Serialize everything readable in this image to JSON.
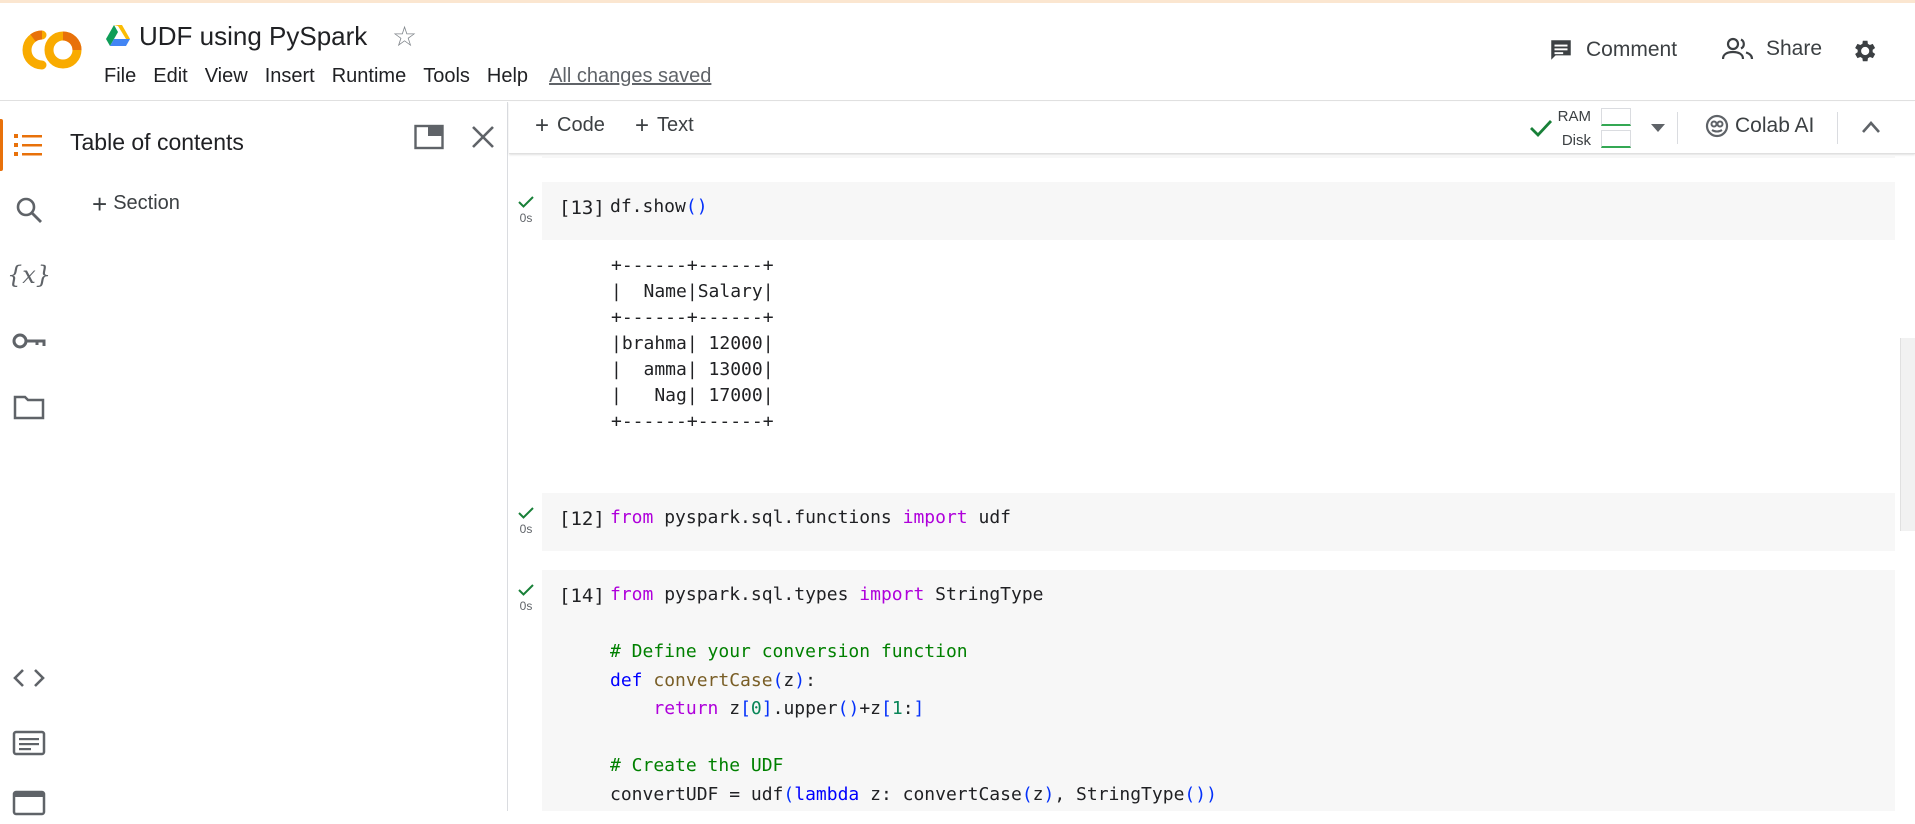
{
  "header": {
    "title": "UDF using PySpark",
    "logo_text": "CO",
    "menu": [
      "File",
      "Edit",
      "View",
      "Insert",
      "Runtime",
      "Tools",
      "Help"
    ],
    "save_status": "All changes saved",
    "comment_label": "Comment",
    "share_label": "Share"
  },
  "sidebar": {
    "rail_icons": [
      "toc-icon",
      "search-icon",
      "variables-icon",
      "secrets-key-icon",
      "folder-icon",
      "code-snippets-icon",
      "command-palette-icon",
      "terminal-icon"
    ],
    "toc_title": "Table of contents",
    "add_section_label": "Section"
  },
  "toolbar": {
    "code_label": "Code",
    "text_label": "Text",
    "ram_label": "RAM",
    "disk_label": "Disk",
    "colab_ai_label": "Colab AI"
  },
  "colors": {
    "accent": "#e8710a",
    "success": "#188038",
    "keyword": "#af00db",
    "comment": "#008000"
  },
  "cells": [
    {
      "prompt": "[13]",
      "time": "0s",
      "code_text": "df.show()",
      "output_lines": [
        "+------+------+",
        "|  Name|Salary|",
        "+------+------+",
        "|brahma| 12000|",
        "|  amma| 13000|",
        "|   Nag| 17000|",
        "+------+------+"
      ]
    },
    {
      "prompt": "[12]",
      "time": "0s",
      "code_text": "from pyspark.sql.functions import udf"
    },
    {
      "prompt": "[14]",
      "time": "0s",
      "code_text": "from pyspark.sql.types import StringType\n\n# Define your conversion function\ndef convertCase(z):\n    return z[0].upper()+z[1:]\n\n# Create the UDF\nconvertUDF = udf(lambda z: convertCase(z), StringType())"
    }
  ]
}
